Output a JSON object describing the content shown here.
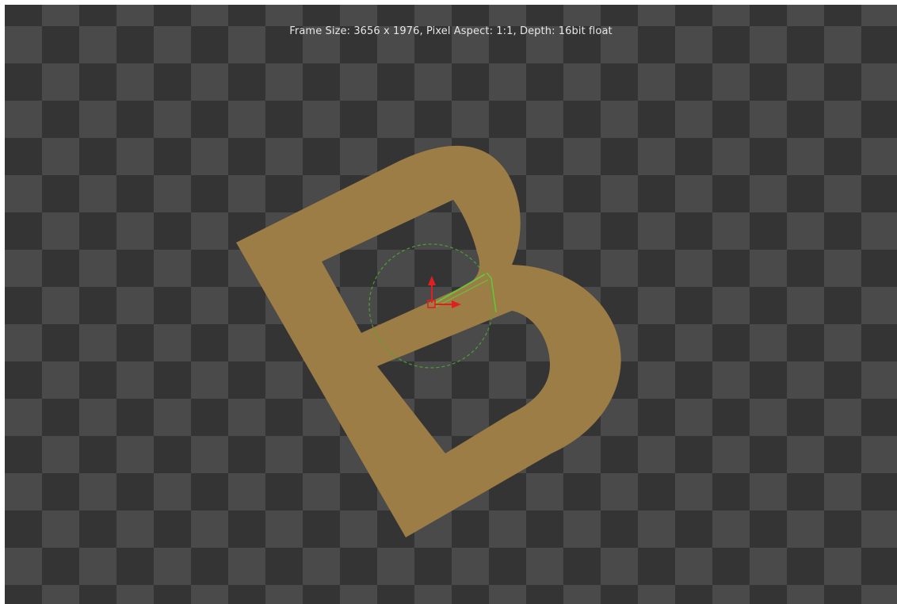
{
  "viewer": {
    "frame_info": "Frame Size: 3656 x 1976, Pixel Aspect: 1:1, Depth: 16bit float",
    "background": "transparency-checkerboard"
  },
  "layer": {
    "text": "B",
    "fill_color": "#9b7d45"
  },
  "transform_gizmo": {
    "axis_color": "#e02020",
    "rotation_ring_color": "#4ca92e",
    "icons": [
      "move-y-arrow-icon",
      "move-x-arrow-icon",
      "anchor-point-icon",
      "rotation-ring-icon"
    ]
  }
}
